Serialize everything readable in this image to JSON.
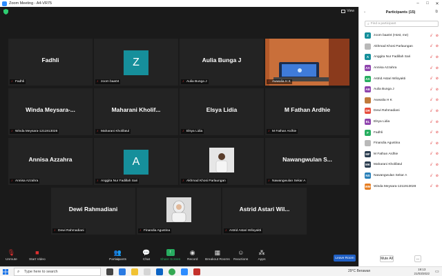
{
  "window": {
    "title": "Zoom Meeting - A4-VR75"
  },
  "view": {
    "label": "View"
  },
  "tiles": [
    {
      "big": "Fadhli",
      "label": "Fadhli"
    },
    {
      "avatar": "Z",
      "label": "zoom baa04"
    },
    {
      "big": "Aulia Bunga J",
      "label": "Aulia Bunga J"
    },
    {
      "label": "Awwalia H K"
    },
    {
      "big": "Winda  Meysara-...",
      "label": "Winda Meysara-1211913028"
    },
    {
      "big": "Maharani  Kholif...",
      "label": "Maharani Kholifatul"
    },
    {
      "big": "Elsya Lidia",
      "label": "Elsya Lidia"
    },
    {
      "big": "M Fathan Ardhie",
      "label": "M Fathan Ardhie"
    },
    {
      "big": "Annisa Azzahra",
      "label": "Annisa Azzahra"
    },
    {
      "avatar": "A",
      "label": "Anggita Nur Fadillah Sari"
    },
    {
      "label": "Akhmad Khosi Parlaungan"
    },
    {
      "big": "Nawangwulan  S...",
      "label": "Nawangwulan Sekar A"
    },
    {
      "big": "Dewi Rahmadiani",
      "label": "Dewi Rahmadiani"
    },
    {
      "label": "Finandia Agustina"
    },
    {
      "big": "Astrid  Astari  Wil...",
      "label": "Astrid Astari Wiloyakti"
    }
  ],
  "toolbar": {
    "unmute": "Unmute",
    "start_video": "Start Video",
    "participants": "Participants",
    "participants_count": "15",
    "chat": "Chat",
    "share": "Share Screen",
    "record": "Record",
    "breakout": "Breakout Rooms",
    "reactions": "Reactions",
    "apps": "Apps",
    "leave": "Leave Room"
  },
  "panel": {
    "title": "Participants (15)",
    "search_placeholder": "Find a participant",
    "mute_all": "Mute All",
    "more": "...",
    "participants": [
      {
        "initials": "Z",
        "name": "zoom baa04 (Host, me)",
        "color": "#168f9b"
      },
      {
        "initials": "",
        "name": "Akhmad Khosi Parlaungan",
        "color": "#b9b9b9"
      },
      {
        "initials": "A",
        "name": "Anggita Nur Fadillah Sari",
        "color": "#168f9b"
      },
      {
        "initials": "AA",
        "name": "Annisa Azzahra",
        "color": "#8e44ad"
      },
      {
        "initials": "AA",
        "name": "Astrid Astari Wiloyakti",
        "color": "#27ae60"
      },
      {
        "initials": "AB",
        "name": "Aulia Bunga J",
        "color": "#8e44ad"
      },
      {
        "initials": "",
        "name": "Awwalia H K",
        "color": "#c07a3a"
      },
      {
        "initials": "DR",
        "name": "Dewi Rahmadiani",
        "color": "#e74c3c"
      },
      {
        "initials": "EL",
        "name": "Elsya Lidia",
        "color": "#8e44ad"
      },
      {
        "initials": "F",
        "name": "Fadhli",
        "color": "#27ae60"
      },
      {
        "initials": "",
        "name": "Finandia Agustina",
        "color": "#b9b9b9"
      },
      {
        "initials": "MF",
        "name": "M Fathan Ardhie",
        "color": "#2c3e50"
      },
      {
        "initials": "MK",
        "name": "Maharani Kholifatul",
        "color": "#2c3e50"
      },
      {
        "initials": "NS",
        "name": "Nawangwulan Sekar A",
        "color": "#2980b9"
      },
      {
        "initials": "WM",
        "name": "Winda Meysara-1211913028",
        "color": "#e67e22"
      }
    ]
  },
  "taskbar": {
    "search_placeholder": "Type here to search",
    "weather": "29°C  Berawan",
    "time": "19:13",
    "date": "21/03/2022"
  }
}
